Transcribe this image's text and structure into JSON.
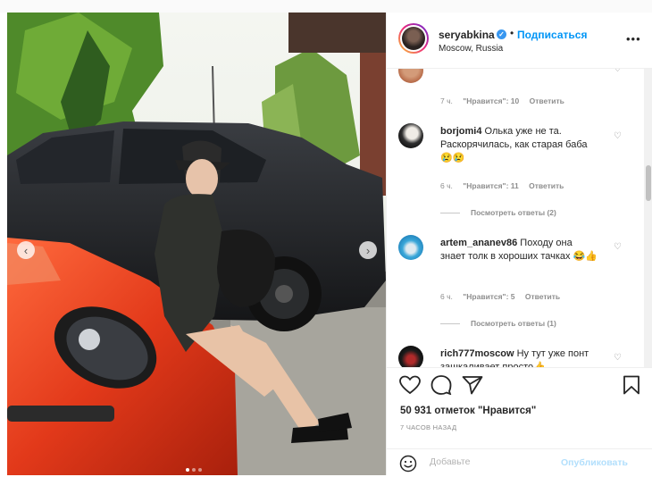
{
  "header": {
    "username": "seryabkina",
    "verified_icon": "verified-badge-icon",
    "dot": "•",
    "follow_label": "Подписаться",
    "location": "Moscow, Russia",
    "more_label": "•••"
  },
  "photo": {
    "prev_label": "‹",
    "next_label": "›",
    "slide_count": 3,
    "active_slide": 1
  },
  "comments": [
    {
      "username": "",
      "text": "",
      "time": "7 ч.",
      "likes": "\"Нравится\": 10",
      "reply": "Ответить"
    },
    {
      "username": "borjomi4",
      "text": " Олька уже не та. Раскорячилась, как старая баба😢😢",
      "time": "6 ч.",
      "likes": "\"Нравится\": 11",
      "reply": "Ответить",
      "view_replies": "Посмотреть ответы (2)"
    },
    {
      "username": "artem_ananev86",
      "text": " Походу она знает толк в хороших тачках 😂👍",
      "time": "6 ч.",
      "likes": "\"Нравится\": 5",
      "reply": "Ответить",
      "view_replies": "Посмотреть ответы (1)"
    },
    {
      "username": "rich777moscow",
      "text": " Ну тут уже понт зашкаливает просто👍"
    }
  ],
  "actions": {
    "like_icon": "heart-icon",
    "comment_icon": "comment-bubble-icon",
    "share_icon": "paper-plane-icon",
    "save_icon": "bookmark-icon",
    "likes_count": "50 931 отметок \"Нравится\"",
    "time_ago": "7 ЧАСОВ НАЗАД"
  },
  "add_comment": {
    "emoji_icon": "smiley-icon",
    "placeholder": "Добавьте",
    "publish_label": "Опубликовать"
  },
  "colors": {
    "accent": "#0095f6",
    "verified": "#3897f0",
    "muted": "#8e8e8e",
    "publish_disabled": "#b2dffc"
  }
}
